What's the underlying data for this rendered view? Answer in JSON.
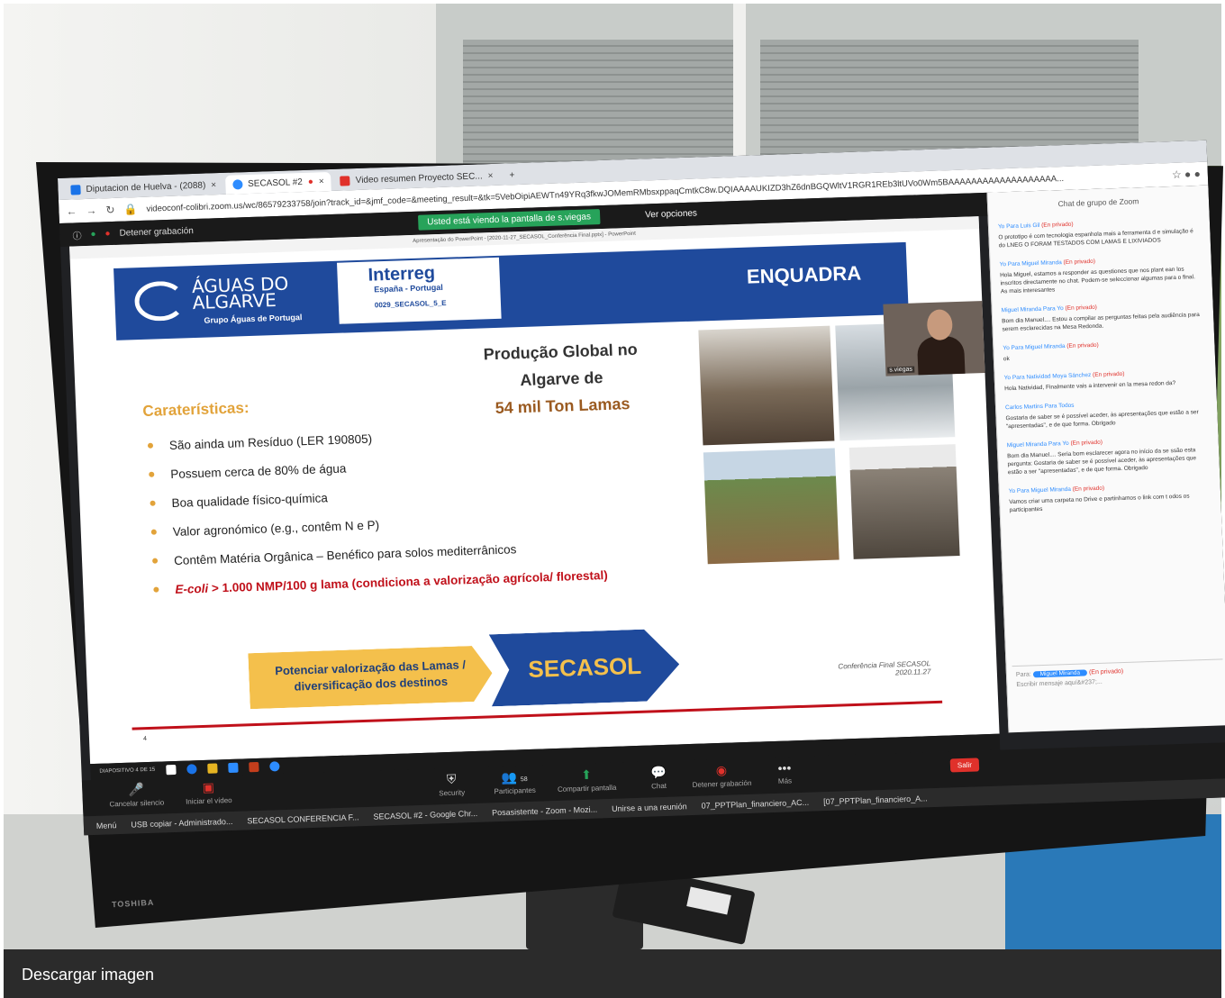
{
  "browser": {
    "tabs": [
      {
        "label": "Diputacion de Huelva - (2088)",
        "color": "#1a73e8"
      },
      {
        "label": "SECASOL #2",
        "color": "#2d8cff"
      },
      {
        "label": "Video resumen Proyecto SEC...",
        "color": "#e0312b"
      }
    ],
    "url": "videoconf-colibri.zoom.us/wc/86579233758/join?track_id=&jmf_code=&meeting_result=&tk=5VebOipiAEWTn49YRq3fkwJOMemRMbsxppaqCmtkC8w.DQIAAAAUKIZD3hZ6dnBGQWltV1RGR1REb3ltUVo0Wm5BAAAAAAAAAAAAAAAAAAA..."
  },
  "zoom": {
    "recording_label": "Detener grabación",
    "viewing_label": "Usted está viendo la pantalla de s.viegas",
    "view_options": "Ver opciones",
    "video_name": "s.viegas",
    "controls": {
      "mute": "Cancelar silencio",
      "video": "Iniciar el vídeo",
      "security": "Security",
      "participants": "Participantes",
      "participants_count": "58",
      "share": "Compartir pantalla",
      "chat": "Chat",
      "record": "Detener grabación",
      "more": "Más",
      "leave": "Salir"
    }
  },
  "slide": {
    "window_title": "Apresentação do PowerPoint - [2020-11-27_SECASOL_Conferência Final.pptx] - PowerPoint",
    "logo_title_1": "ÁGUAS DO",
    "logo_title_2": "ALGARVE",
    "logo_sub": "Grupo Águas de Portugal",
    "interreg_title": "Interreg",
    "interreg_sub": "España - Portugal",
    "interreg_code": "0029_SECASOL_5_E",
    "heading": "ENQUADRA",
    "production_1": "Produção Global no",
    "production_2": "Algarve de",
    "production_3": "54 mil Ton Lamas",
    "features_title": "Caraterísticas:",
    "bullets": [
      "São ainda um Resíduo (LER 190805)",
      "Possuem cerca de 80% de água",
      "Boa qualidade físico-química",
      "Valor agronómico (e.g., contêm N e P)",
      "Contêm Matéria Orgânica – Benéfico para solos mediterrânicos"
    ],
    "bullet_red_prefix": "E-coli",
    "bullet_red_rest": " > 1.000 NMP/100 g lama (condiciona a valorização agrícola/ florestal)",
    "callout": "Potenciar valorização das Lamas / diversificação dos destinos",
    "arrow_label": "SECASOL",
    "conference_1": "Conferência Final SECASOL",
    "conference_2": "2020.11.27",
    "page_number": "4",
    "slide_counter": "DIAPOSITIVO 4 DE 15"
  },
  "chat": {
    "title": "Chat de grupo de Zoom",
    "messages": [
      {
        "header": "Yo Para Luis Gil",
        "priv": "(En privado)",
        "text": "O prototipo é com tecnologia espanhola mais a ferramenta d e simulação é do LNEG O FORAM TESTADOS COM LAMAS E LIXIVIADOS"
      },
      {
        "header": "Yo Para Miguel Miranda",
        "priv": "(En privado)",
        "text": "Hola Miguel, estamos a responder as questiones que nos plant ean los inscritos directamente no chat. Podem-se seleccionar algumas para o final. As mais interesantes"
      },
      {
        "header": "Miguel Miranda Para Yo",
        "priv": "(En privado)",
        "text": "Bom dia Manuel.... Estou a compilar as perguntas feitas pela audiência para serem esclarecidas na Mesa Redonda."
      },
      {
        "header": "Yo Para Miguel Miranda",
        "priv": "(En privado)",
        "text": "ok"
      },
      {
        "header": "Yo Para Natividad Moya Sánchez",
        "priv": "(En privado)",
        "text": "Hola Natividad, Finalmente vais a intervenir en la mesa redon da?"
      },
      {
        "header": "Carlos Martins Para Todos",
        "priv": "",
        "text": "Gostaria de saber se é possível aceder, às apresentações que estão a ser \"apresentadas\", e de que forma. Obrigado"
      },
      {
        "header": "Miguel Miranda Para Yo",
        "priv": "(En privado)",
        "text": "Bom dia Manuel.... Seria bom esclarecer agora no início da se ssão esta pergunta: Gostaria de saber se é possível aceder, às apresentações que estão a ser \"apresentadas\", e de que forma. Obrigado"
      },
      {
        "header": "Yo Para Miguel Miranda",
        "priv": "(En privado)",
        "text": "Vamos criar uma carpeta no Drive e partinhamos o link com t odos os participantes"
      }
    ],
    "to_label": "Para:",
    "to_chip": "Miguel Miranda",
    "to_priv": "(En privado)",
    "input_placeholder": "Escribir mensaje aquí&#237;..."
  },
  "taskbar": {
    "items": [
      "Menú",
      "USB copiar - Administrado...",
      "SECASOL CONFERENCIA F...",
      "SECASOL #2 - Google Chr...",
      "Posasistente - Zoom - Mozi...",
      "Unirse a una reunión",
      "07_PPTPlan_financiero_AC...",
      "[07_PPTPlan_financiero_A..."
    ]
  },
  "monitor_brand": "TOSHIBA",
  "footer": {
    "download": "Descargar imagen"
  }
}
